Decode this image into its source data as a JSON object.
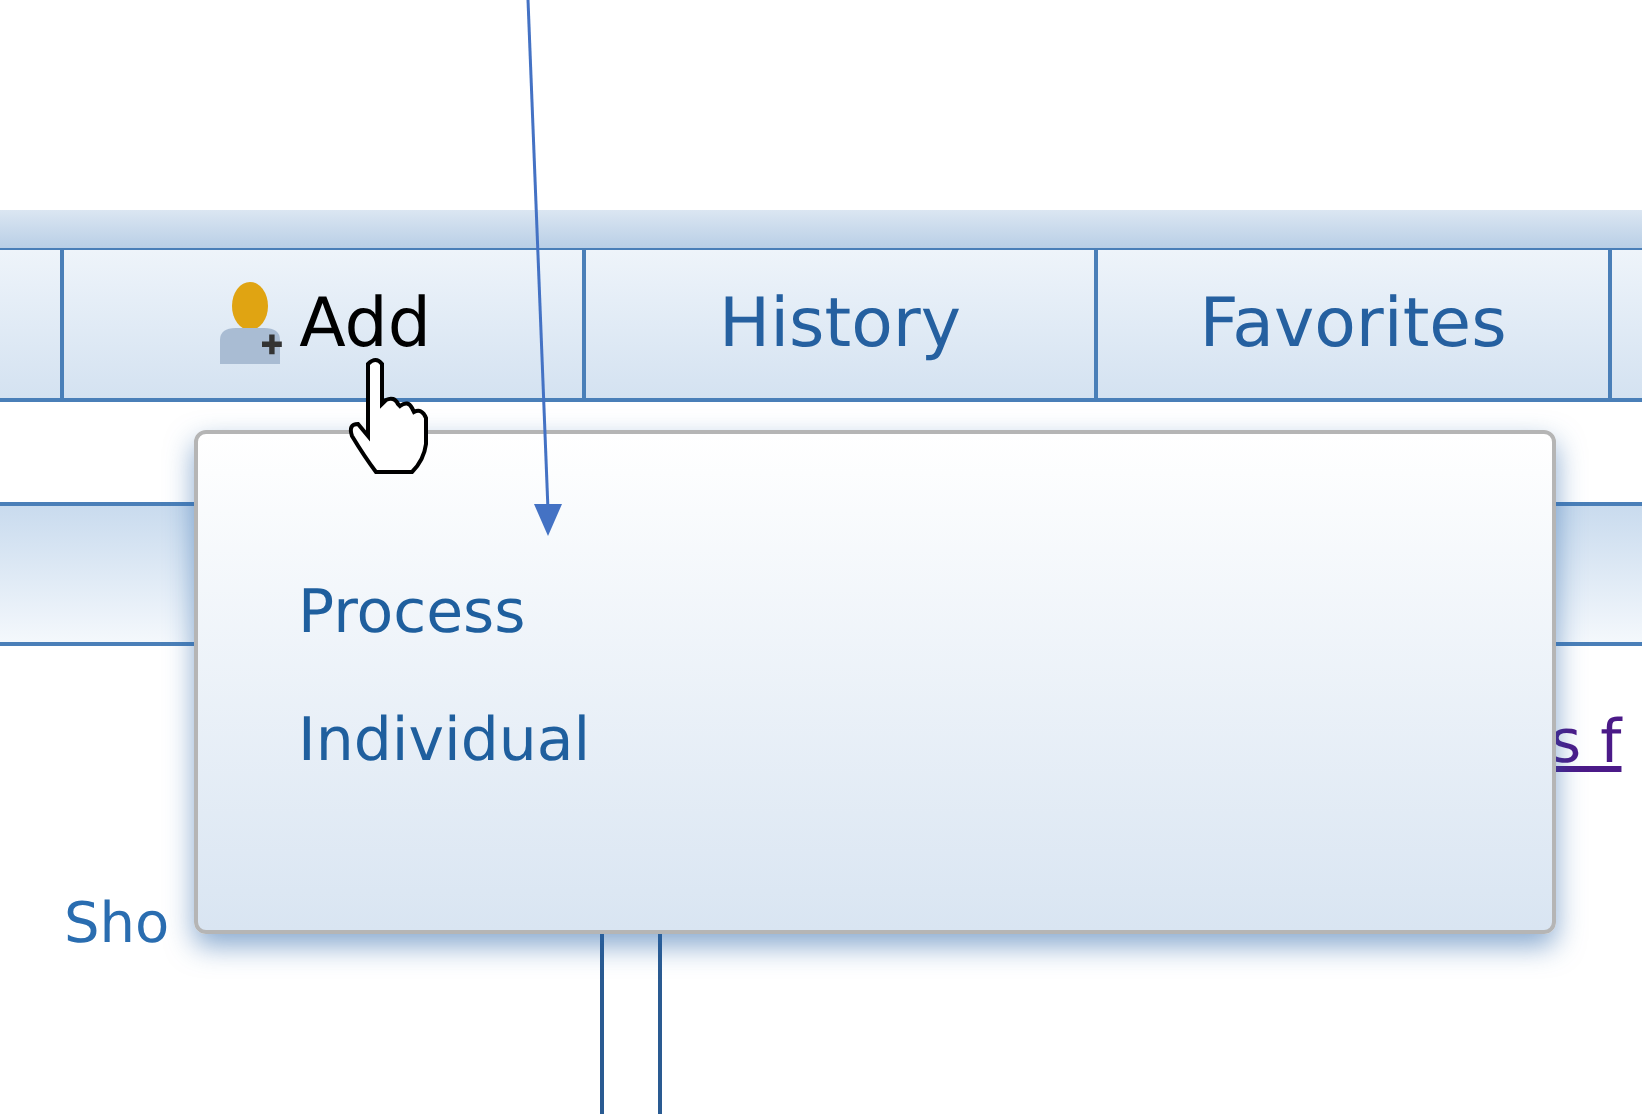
{
  "tabs": [
    {
      "label": "Add",
      "selected": true,
      "kind": "add-person"
    },
    {
      "label": "History",
      "selected": false
    },
    {
      "label": "Favorites",
      "selected": false
    }
  ],
  "menu": {
    "items": [
      {
        "label": "Process"
      },
      {
        "label": "Individual"
      }
    ]
  },
  "content": {
    "left_text": "Sho",
    "link_text": "s f"
  }
}
